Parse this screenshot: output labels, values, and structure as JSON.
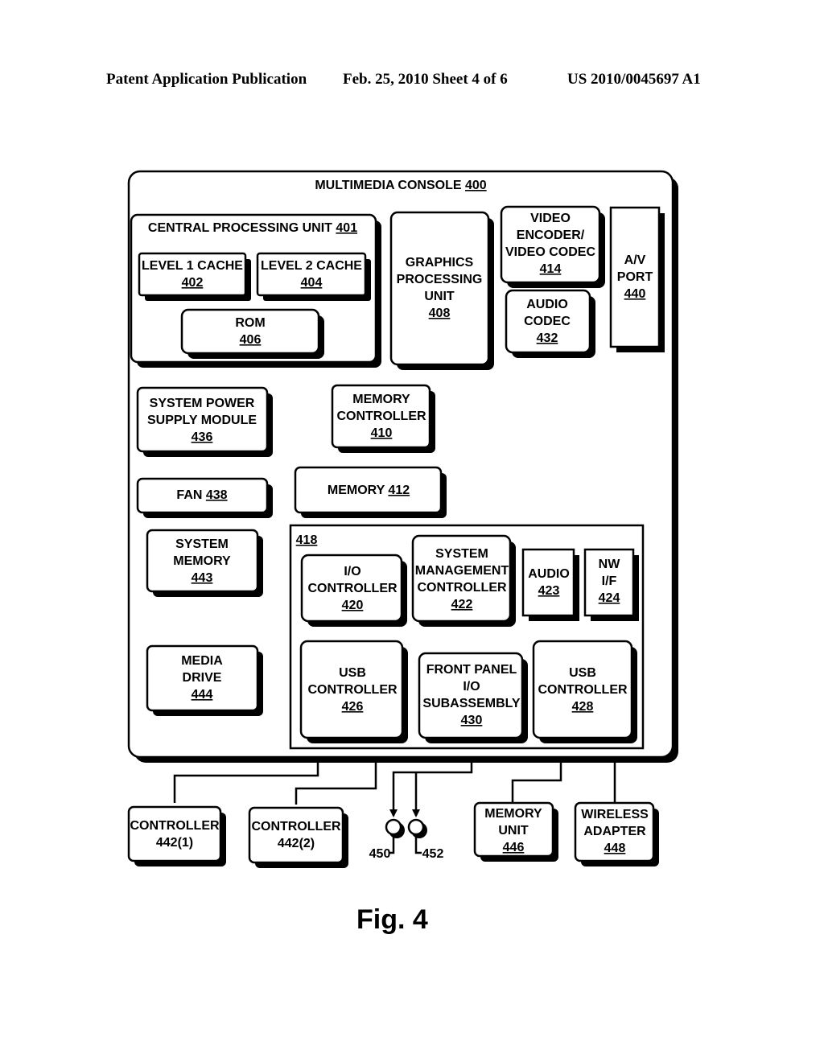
{
  "header": {
    "left": "Patent Application Publication",
    "middle": "Feb. 25, 2010   Sheet 4 of 6",
    "right": "US 2010/0045697 A1"
  },
  "figure_label": "Fig. 4",
  "diagram": {
    "console": {
      "title": "MULTIMEDIA CONSOLE",
      "ref": "400"
    },
    "cpu": {
      "title": "CENTRAL PROCESSING UNIT",
      "ref": "401"
    },
    "blocks": {
      "l1": {
        "lines": [
          "LEVEL 1 CACHE"
        ],
        "ref": "402"
      },
      "l2": {
        "lines": [
          "LEVEL 2 CACHE"
        ],
        "ref": "404"
      },
      "rom": {
        "lines": [
          "ROM"
        ],
        "ref": "406"
      },
      "gpu": {
        "lines": [
          "GRAPHICS",
          "PROCESSING",
          "UNIT"
        ],
        "ref": "408"
      },
      "venc": {
        "lines": [
          "VIDEO",
          "ENCODER/",
          "VIDEO CODEC"
        ],
        "ref": "414"
      },
      "acodec": {
        "lines": [
          "AUDIO",
          "CODEC"
        ],
        "ref": "432"
      },
      "avport": {
        "lines": [
          "A/V",
          "PORT"
        ],
        "ref": "440"
      },
      "psu": {
        "lines": [
          "SYSTEM POWER",
          "SUPPLY MODULE"
        ],
        "ref": "436"
      },
      "memctl": {
        "lines": [
          "MEMORY",
          "CONTROLLER"
        ],
        "ref": "410"
      },
      "fan": {
        "lines": [
          "FAN"
        ],
        "ref": "438",
        "inline": true
      },
      "mem": {
        "lines": [
          "MEMORY"
        ],
        "ref": "412",
        "inline": true
      },
      "sysmem": {
        "lines": [
          "SYSTEM",
          "MEMORY"
        ],
        "ref": "443"
      },
      "media": {
        "lines": [
          "MEDIA",
          "DRIVE"
        ],
        "ref": "444"
      },
      "ioctl": {
        "lines": [
          "I/O",
          "CONTROLLER"
        ],
        "ref": "420"
      },
      "smc": {
        "lines": [
          "SYSTEM",
          "MANAGEMENT",
          "CONTROLLER"
        ],
        "ref": "422"
      },
      "audio": {
        "lines": [
          "AUDIO"
        ],
        "ref": "423"
      },
      "nwif": {
        "lines": [
          "NW",
          "I/F"
        ],
        "ref": "424"
      },
      "usb1": {
        "lines": [
          "USB",
          "CONTROLLER"
        ],
        "ref": "426"
      },
      "fpio": {
        "lines": [
          "FRONT PANEL",
          "I/O",
          "SUBASSEMBLY"
        ],
        "ref": "430"
      },
      "usb2": {
        "lines": [
          "USB",
          "CONTROLLER"
        ],
        "ref": "428"
      },
      "ctrl1": {
        "lines": [
          "CONTROLLER"
        ],
        "ref": "442(1)"
      },
      "ctrl2": {
        "lines": [
          "CONTROLLER"
        ],
        "ref": "442(2)"
      },
      "memunit": {
        "lines": [
          "MEMORY",
          "UNIT"
        ],
        "ref": "446"
      },
      "wireless": {
        "lines": [
          "WIRELESS",
          "ADAPTER"
        ],
        "ref": "448"
      }
    },
    "io_subsystem_ref": "418",
    "indicators": [
      {
        "ref": "450"
      },
      {
        "ref": "452"
      }
    ]
  }
}
